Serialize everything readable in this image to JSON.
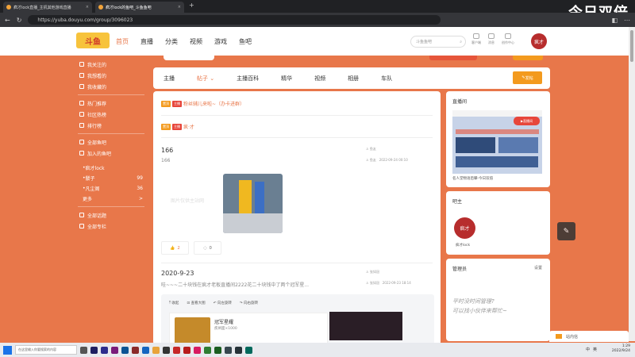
{
  "browser": {
    "tabs": [
      {
        "title": "疯才lock直播_主机其他游戏直播"
      },
      {
        "title": "疯才lock的鱼吧_斗鱼鱼吧"
      }
    ],
    "url": "https://yuba.douyu.com/group/3096023"
  },
  "watermark_brand": "今日双倍",
  "site": {
    "logo": "斗鱼",
    "nav": [
      "首页",
      "直播",
      "分类",
      "视频",
      "游戏",
      "鱼吧"
    ],
    "search_placeholder": "斗鱼鱼吧",
    "top_icons": [
      "客户端",
      "消息",
      "创作中心"
    ],
    "avatar_text": "疯才"
  },
  "left_nav": {
    "items_a": [
      "我关注的",
      "我想看的",
      "我收藏的"
    ],
    "items_b": [
      "热门推荐",
      "社区热榜",
      "排行榜"
    ],
    "items_c": [
      "全部鱼吧",
      "加入的鱼吧"
    ],
    "subs": [
      {
        "name": "疯才lock",
        "count": ""
      },
      {
        "name": "鬃子",
        "count": "99"
      },
      {
        "name": "凡尘阁",
        "count": "36"
      },
      {
        "name": "更多",
        "count": ">"
      }
    ],
    "items_d": [
      "全部话题",
      "全部专栏"
    ]
  },
  "subnav": {
    "tabs": [
      "主播",
      "帖子",
      "主播百科",
      "精华",
      "视频",
      "相册",
      "车队"
    ],
    "active": "帖子",
    "post_button": "发帖"
  },
  "pinned": [
    {
      "badges": [
        "置顶",
        "主播"
      ],
      "title": "粉丝辅儿来啦~（办卡进群）"
    },
    {
      "badges": [
        "置顶",
        "主播"
      ],
      "title": "疯·才"
    }
  ],
  "posts": [
    {
      "title": "166",
      "body": "166",
      "author": "鱼友",
      "time": "2022-09-24 00:10",
      "watermark": "图片仅供主站网",
      "likes": "2",
      "comments": "0"
    },
    {
      "title": "2020-9-23",
      "body": "哇~~~二十块钱在疯才老板直播间2222花二十块钱中了两个冠军星...",
      "author": "张如冠",
      "time": "2022-09-23 18:14",
      "tools": [
        "收起",
        "查看大图",
        "向左旋转",
        "向右旋转"
      ],
      "card_title": "冠军星耀",
      "card_sub": "疾闸面×1000"
    }
  ],
  "right": {
    "live_title": "直播间",
    "live_button": "直播间",
    "live_caption": "名人堂物语后攀-今日双倍",
    "owner_title": "吧主",
    "owner_avatar": "疯才",
    "owner_name": "疯才lock",
    "admin_title": "管理员",
    "admin_link": "设置",
    "admin_note_1": "平时没时间管理?",
    "admin_note_2": "可以找小伙伴来帮忙~"
  },
  "msg_box": "站内信",
  "taskbar": {
    "search": "在这里输入你要搜索的内容",
    "time": "1:29",
    "date": "2022/9/24",
    "ime": "中",
    "tray_lang": "英"
  },
  "colors": {
    "accent": "#e8774a",
    "brand_red": "#e7463b",
    "brand_orange": "#f39a1e"
  }
}
